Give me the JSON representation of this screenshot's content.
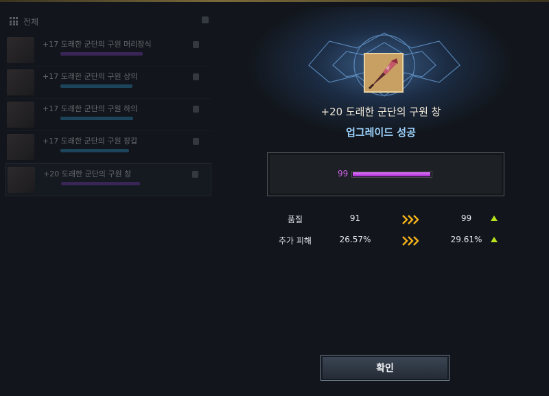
{
  "left_panel": {
    "header_label": "전체",
    "items": [
      {
        "name": "+17 도래한 군단의 구원 머리장식",
        "bar_color": "#7a3fb5"
      },
      {
        "name": "+17 도래한 군단의 구원 상의",
        "bar_color": "#2e8fbf"
      },
      {
        "name": "+17 도래한 군단의 구원 하의",
        "bar_color": "#2e8fbf"
      },
      {
        "name": "+17 도래한 군단의 구원 장갑",
        "bar_color": "#2e8fbf"
      },
      {
        "name": "+20 도래한 군단의 구원 창",
        "bar_color": "#7a3fb5"
      }
    ]
  },
  "result": {
    "item_name": "+20 도래한 군단의 구원 창",
    "status": "업그레이드 성공",
    "quality_value": "99",
    "quality_fill": 0.99
  },
  "stats": [
    {
      "label": "품질",
      "old": "91",
      "new": "99"
    },
    {
      "label": "추가 피해",
      "old": "26.57%",
      "new": "29.61%"
    }
  ],
  "confirm_label": "확인",
  "colors": {
    "accent_gold": "#f7b31a",
    "up_green": "#b9e21e",
    "quality_purple": "#cf63e9",
    "status_blue": "#9fd4ff"
  }
}
